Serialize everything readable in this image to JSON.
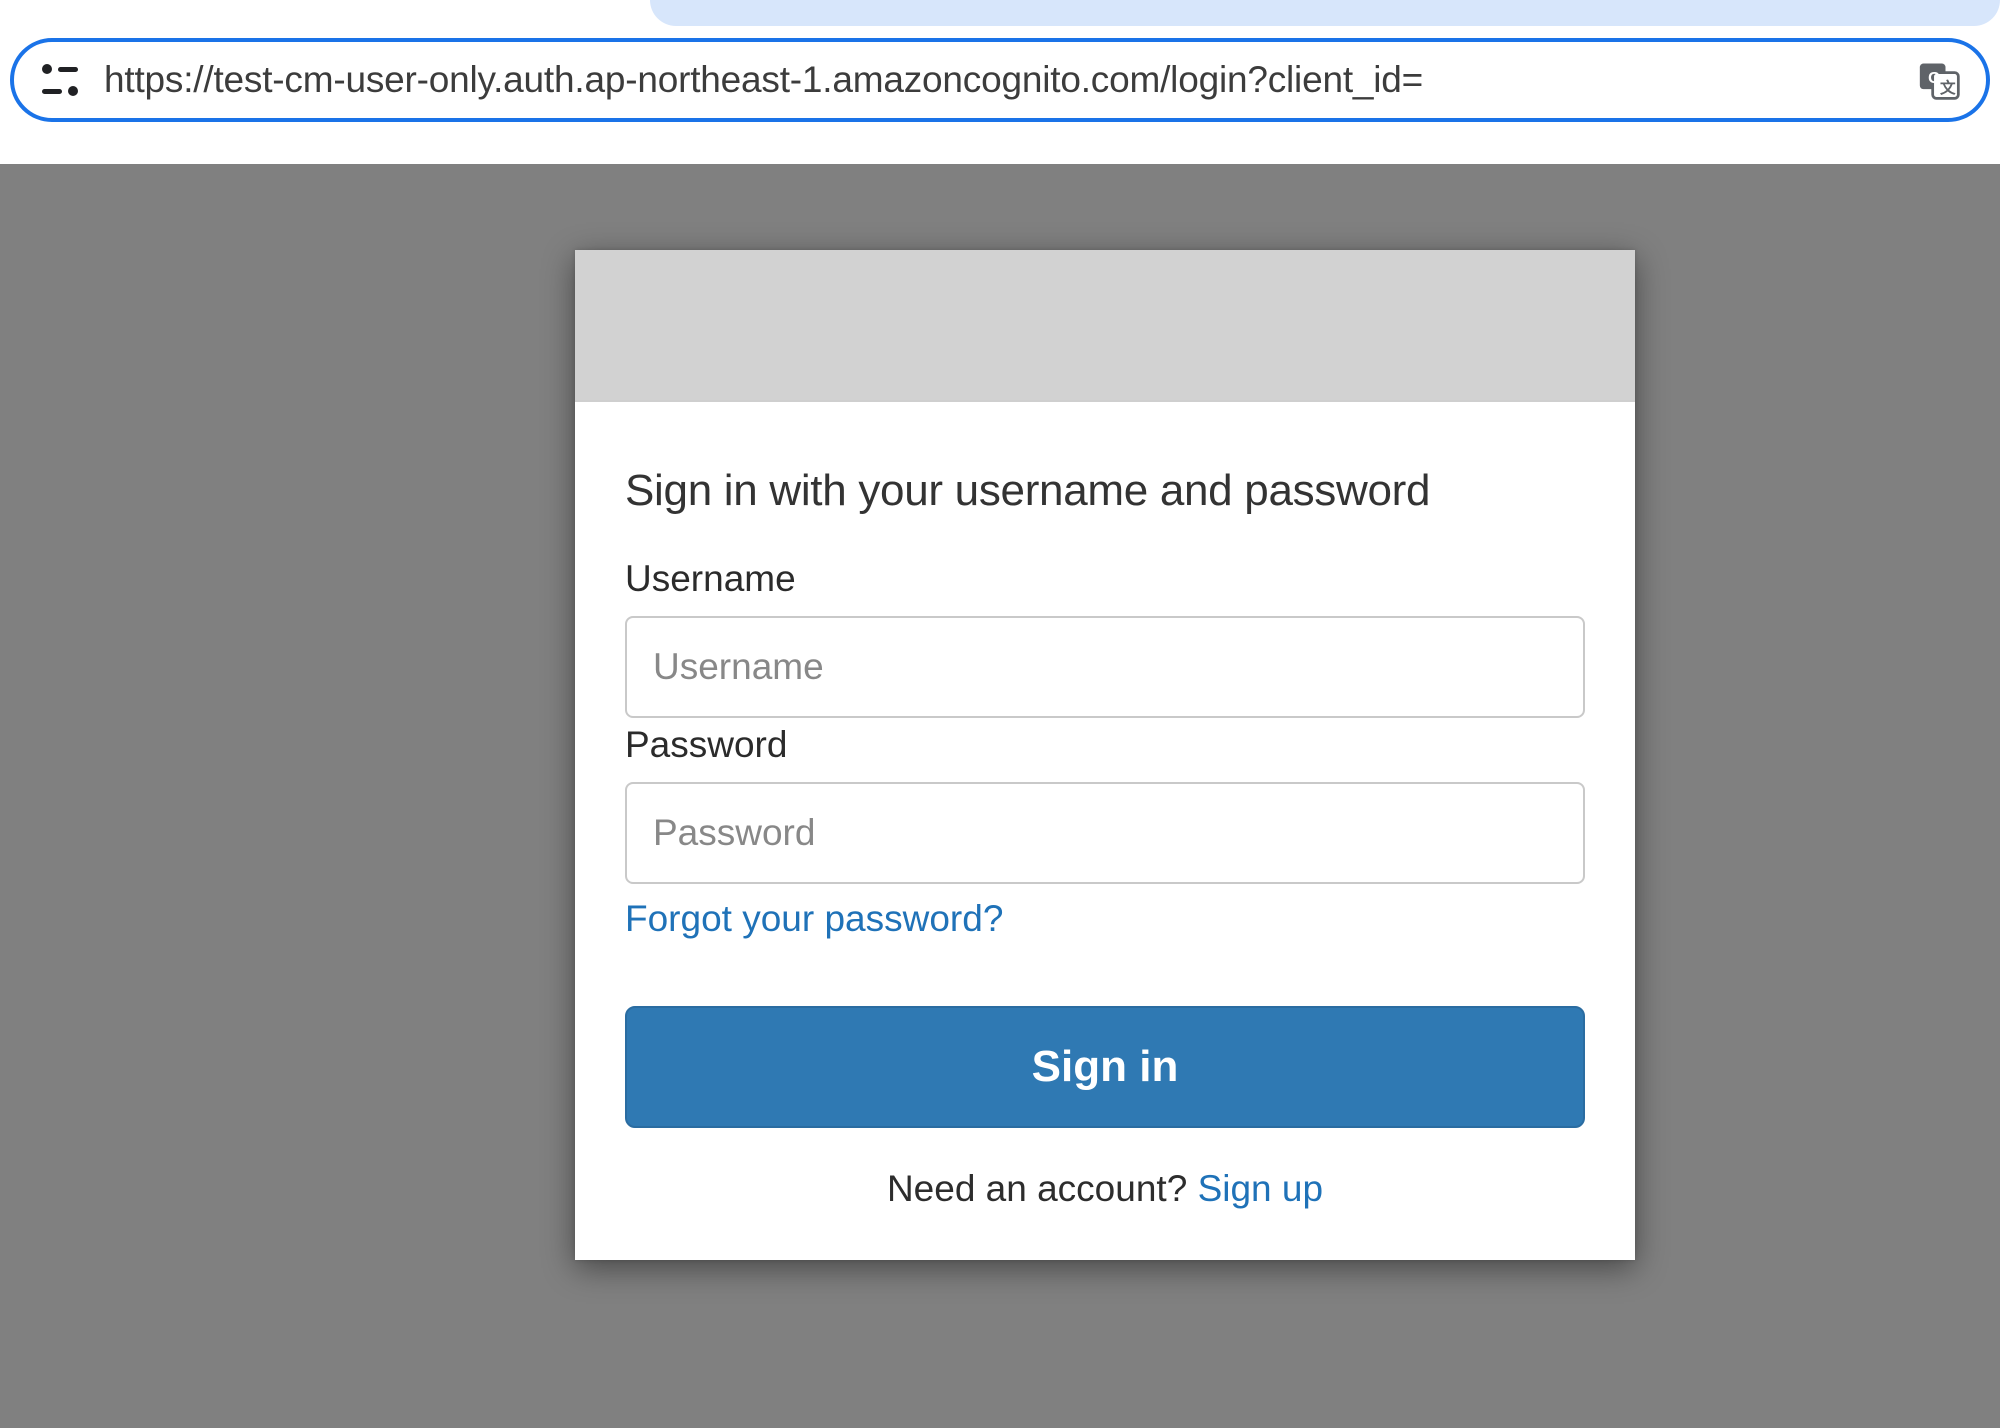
{
  "omnibox": {
    "url": "https://test-cm-user-only.auth.ap-northeast-1.amazoncognito.com/login?client_id="
  },
  "login": {
    "title": "Sign in with your username and password",
    "username_label": "Username",
    "username_placeholder": "Username",
    "password_label": "Password",
    "password_placeholder": "Password",
    "forgot_link": "Forgot your password?",
    "signin_button": "Sign in",
    "need_account_text": "Need an account? ",
    "signup_link": "Sign up"
  }
}
